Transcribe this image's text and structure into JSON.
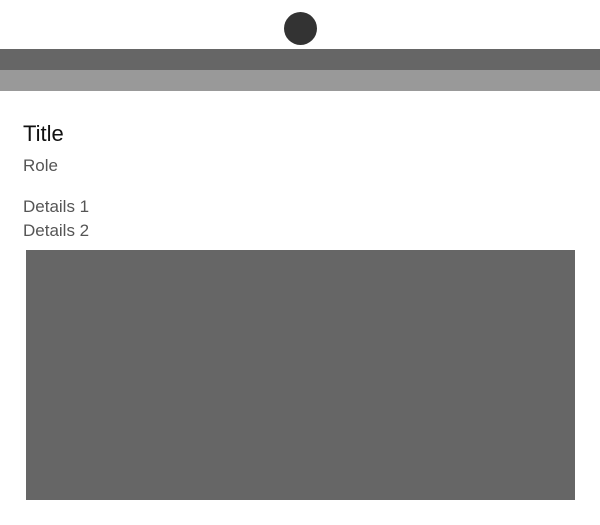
{
  "header": {
    "avatar_color": "#333333",
    "top_bar_color": "#666666",
    "sub_bar_color": "#999999"
  },
  "profile": {
    "title": "Title",
    "role": "Role",
    "details": [
      "Details 1",
      "Details 2"
    ]
  },
  "media": {
    "placeholder_color": "#666666"
  },
  "colors": {
    "text_primary": "#111111",
    "text_secondary": "#555555"
  }
}
